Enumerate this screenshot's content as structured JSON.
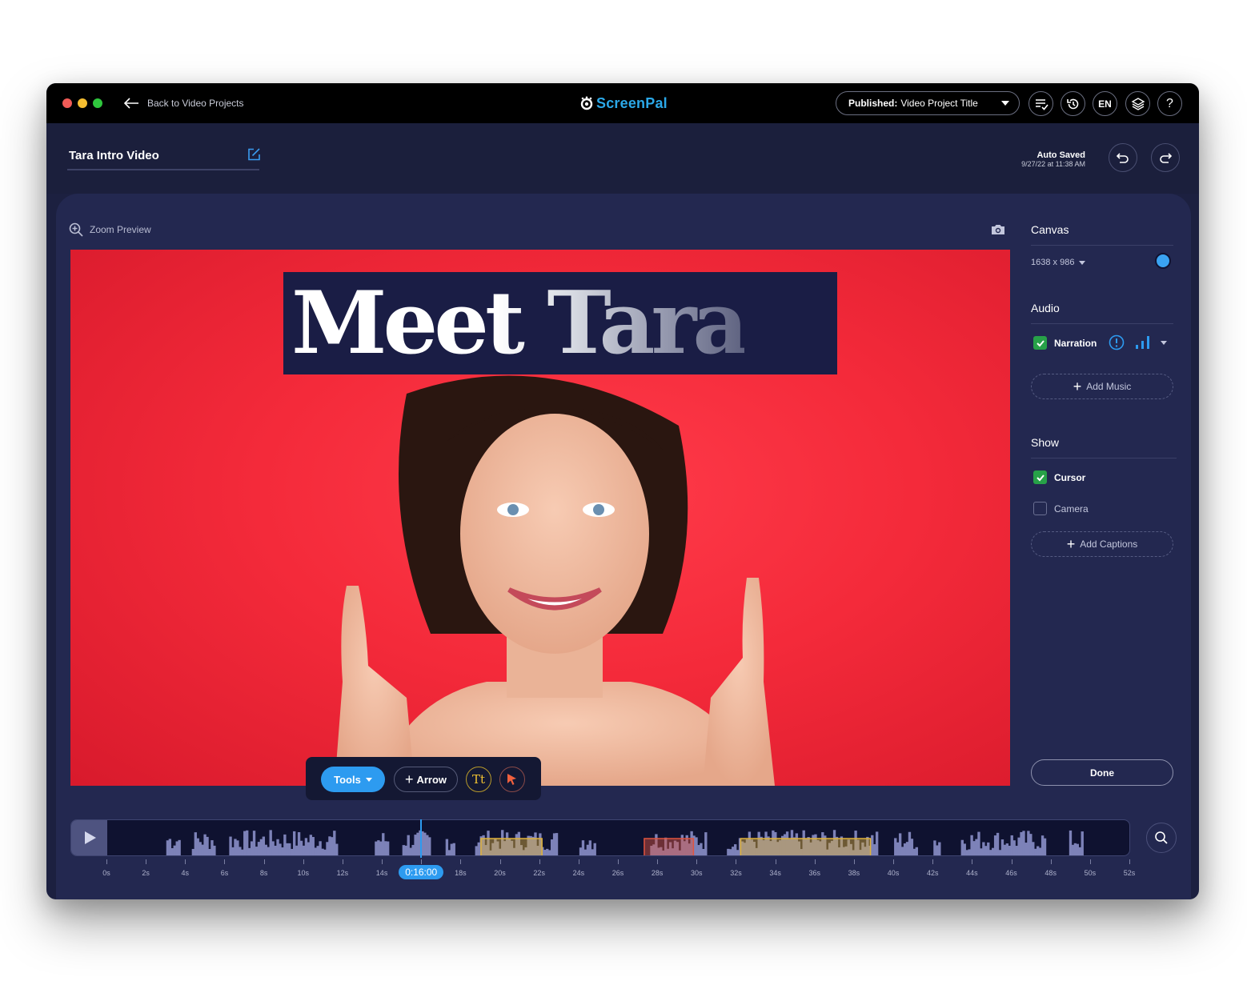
{
  "titlebar": {
    "back_label": "Back to Video Projects",
    "logo_text": "ScreenPal",
    "publish_prefix": "Published:",
    "publish_title": "Video Project Title",
    "lang_label": "EN",
    "help_label": "?"
  },
  "project": {
    "title": "Tara Intro Video",
    "autosave_label": "Auto Saved",
    "autosave_time": "9/27/22 at 11:38 AM"
  },
  "preview": {
    "zoom_label": "Zoom Preview",
    "banner_text": "Meet Tara"
  },
  "tools": {
    "tools_label": "Tools",
    "arrow_label": "Arrow",
    "text_label": "Tt"
  },
  "side": {
    "canvas_heading": "Canvas",
    "canvas_size": "1638 x 986",
    "canvas_color": "#3aa3f2",
    "audio_heading": "Audio",
    "narration_label": "Narration",
    "narration_checked": true,
    "add_music_label": "Add Music",
    "show_heading": "Show",
    "cursor_label": "Cursor",
    "cursor_checked": true,
    "camera_label": "Camera",
    "camera_checked": false,
    "add_captions_label": "Add Captions",
    "done_label": "Done"
  },
  "timeline": {
    "current_time": "0:16:00",
    "current_seconds": 16,
    "duration_seconds": 52,
    "ticks": [
      "0s",
      "2s",
      "4s",
      "6s",
      "8s",
      "10s",
      "12s",
      "14s",
      "16s",
      "18s",
      "20s",
      "22s",
      "24s",
      "26s",
      "28s",
      "30s",
      "32s",
      "34s",
      "36s",
      "38s",
      "40s",
      "42s",
      "44s",
      "46s",
      "48s",
      "50s",
      "52s"
    ],
    "segments": [
      {
        "type": "zoom",
        "start": 19,
        "end": 22.1,
        "color": "#e0b23a"
      },
      {
        "type": "cut",
        "start": 27.3,
        "end": 29.8,
        "color": "#e0543f"
      },
      {
        "type": "zoom",
        "start": 32.2,
        "end": 38.8,
        "color": "#e0b23a"
      }
    ]
  },
  "colors": {
    "accent": "#2d9bf0",
    "background": "#1c2040",
    "panel": "#232850",
    "check_green": "#27a148"
  }
}
